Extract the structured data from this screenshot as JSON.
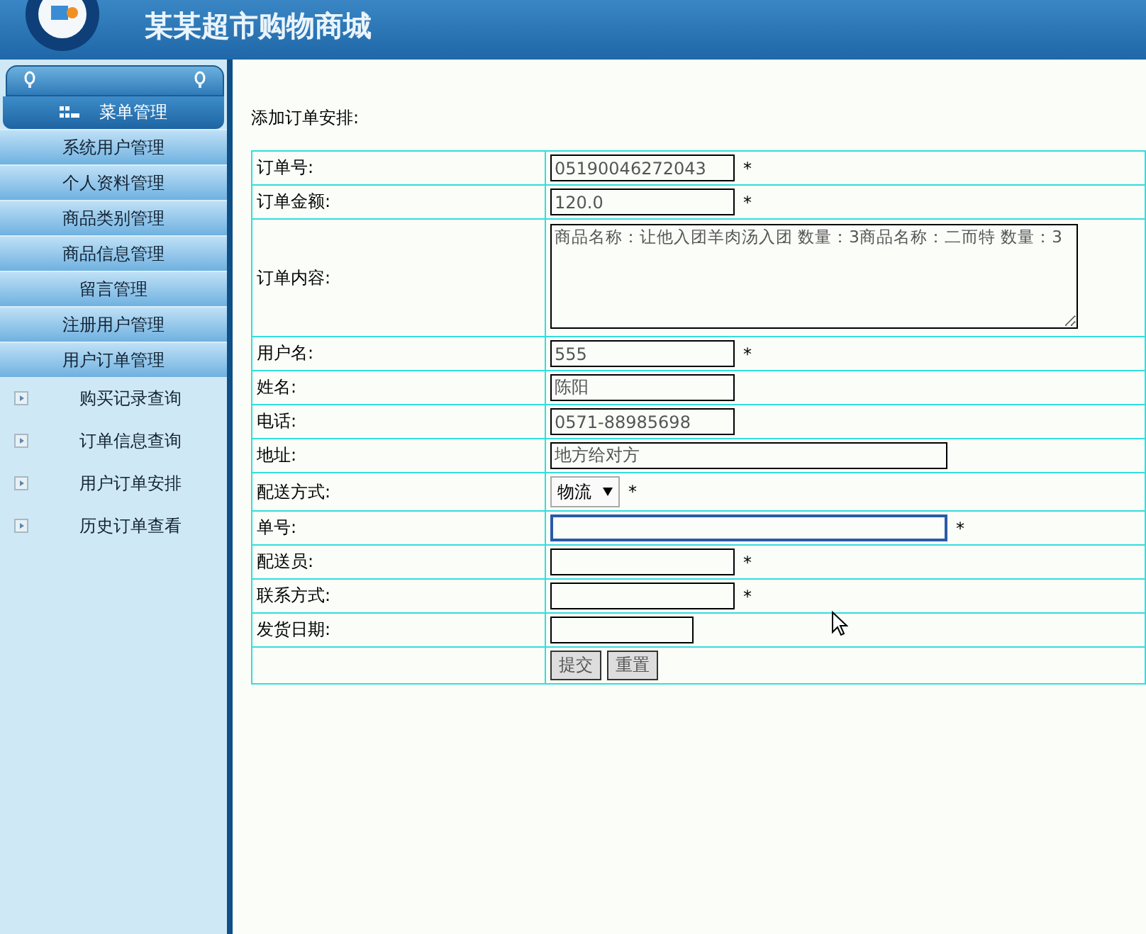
{
  "header": {
    "title": "某某超市购物商城"
  },
  "sidebar": {
    "menu_title": "菜单管理",
    "items": [
      {
        "label": "系统用户管理"
      },
      {
        "label": "个人资料管理"
      },
      {
        "label": "商品类别管理"
      },
      {
        "label": "商品信息管理"
      },
      {
        "label": "留言管理"
      },
      {
        "label": "注册用户管理"
      },
      {
        "label": "用户订单管理",
        "children": [
          {
            "label": "购买记录查询"
          },
          {
            "label": "订单信息查询"
          },
          {
            "label": "用户订单安排"
          },
          {
            "label": "历史订单查看"
          }
        ]
      }
    ]
  },
  "form": {
    "title": "添加订单安排:",
    "rows": [
      {
        "kind": "short",
        "label": "订单号:",
        "value": "05190046272043",
        "focused": false,
        "required_mark": "*"
      },
      {
        "kind": "short",
        "label": "订单金额:",
        "value": "120.0",
        "focused": false,
        "required_mark": "*"
      },
      {
        "kind": "textarea",
        "label": "订单内容:",
        "value": "商品名称：让他入团羊肉汤入团 数量：3商品名称：二而特 数量：3"
      },
      {
        "kind": "short",
        "label": "用户名:",
        "value": "555",
        "focused": false,
        "required_mark": "*"
      },
      {
        "kind": "short",
        "label": "姓名:",
        "value": "陈阳",
        "focused": false
      },
      {
        "kind": "short",
        "label": "电话:",
        "value": "0571-88985698",
        "focused": false
      },
      {
        "kind": "long",
        "label": "地址:",
        "value": "地方给对方",
        "focused": false
      },
      {
        "kind": "select",
        "label": "配送方式:",
        "value": "物流",
        "required_mark": "*"
      },
      {
        "kind": "long",
        "label": "单号:",
        "focused": true,
        "required_mark": "*"
      },
      {
        "kind": "short",
        "label": "配送员:",
        "focused": false,
        "required_mark": "*"
      },
      {
        "kind": "short",
        "label": "联系方式:",
        "focused": false,
        "required_mark": "*"
      },
      {
        "kind": "date",
        "label": "发货日期:",
        "focused": false
      },
      {
        "kind": "buttons",
        "buttons": [
          "提交",
          "重置"
        ]
      }
    ]
  }
}
